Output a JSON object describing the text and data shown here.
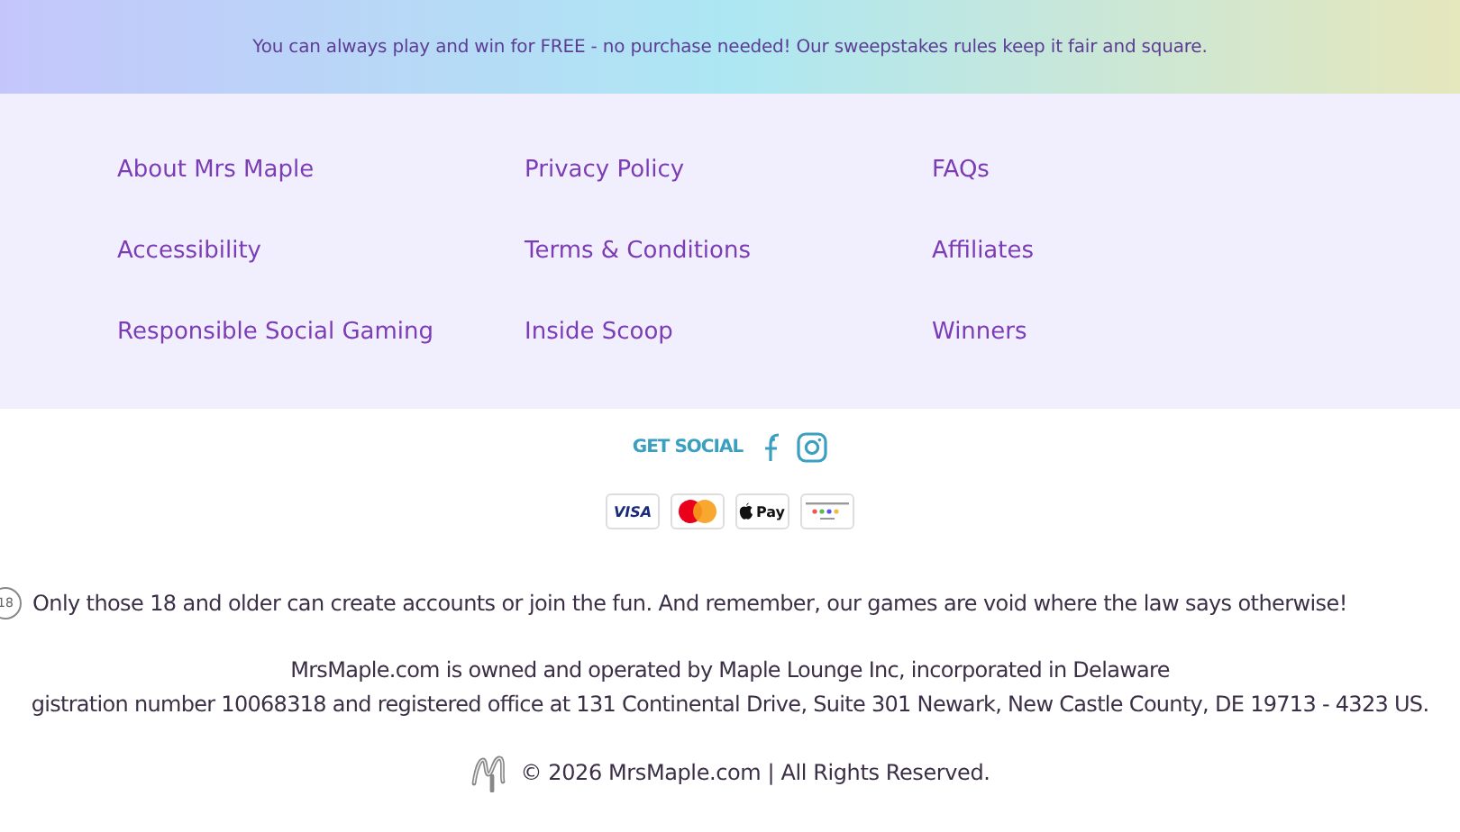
{
  "banner": {
    "text": "You can always play and win for FREE - no purchase needed! Our sweepstakes rules keep it fair and square."
  },
  "footer_links": [
    {
      "label": "About Mrs Maple"
    },
    {
      "label": "Privacy Policy"
    },
    {
      "label": "FAQs"
    },
    {
      "label": "Accessibility"
    },
    {
      "label": "Terms & Conditions"
    },
    {
      "label": "Affiliates"
    },
    {
      "label": "Responsible Social Gaming"
    },
    {
      "label": "Inside Scoop"
    },
    {
      "label": "Winners"
    }
  ],
  "social": {
    "label": "GET SOCIAL",
    "icons": [
      {
        "kind": "facebook"
      },
      {
        "kind": "instagram"
      }
    ]
  },
  "payments": [
    {
      "kind": "visa",
      "label": "VISA"
    },
    {
      "kind": "mastercard"
    },
    {
      "kind": "applepay",
      "label": "Pay"
    },
    {
      "kind": "bank"
    }
  ],
  "age_notice": {
    "badge": "18",
    "text": "Only those 18 and older can create accounts or join the fun. And remember, our games are void where the law says otherwise!"
  },
  "company": [
    "MrsMaple.com is owned and operated by Maple Lounge Inc, incorporated in Delaware",
    "gistration number 10068318 and registered office at 131 Continental Drive, Suite 301 Newark, New Castle County, DE 19713 - 4323 US."
  ],
  "copyright": "© 2026 MrsMaple.com | All Rights Reserved."
}
